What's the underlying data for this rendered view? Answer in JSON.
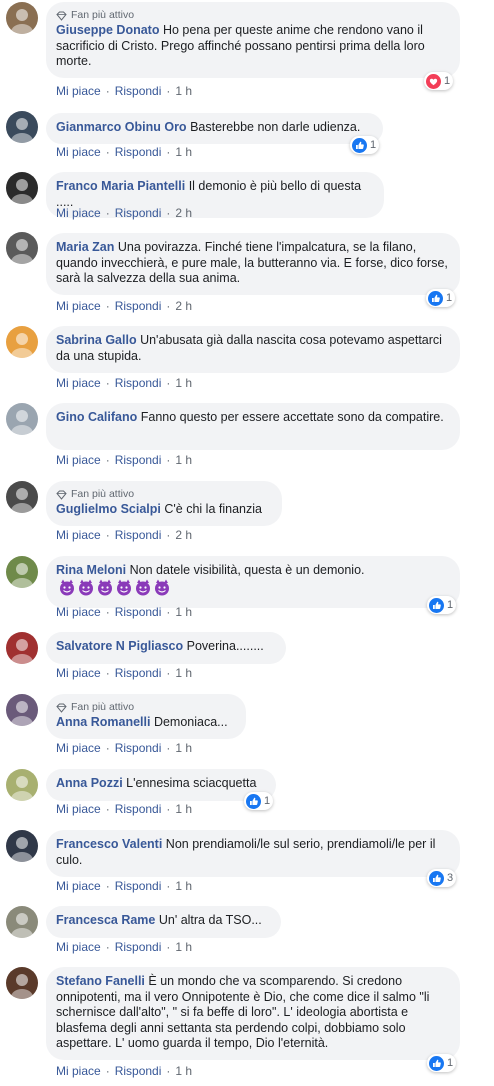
{
  "labels": {
    "fan_badge": "Fan più attivo",
    "like": "Mi piace",
    "reply": "Rispondi",
    "separator": "·"
  },
  "colors": {
    "link": "#385898",
    "bubble": "#f2f3f5",
    "muted": "#606770",
    "like_blue": "#1877f2",
    "love_red": "#f33e58"
  },
  "comments": [
    {
      "fan": true,
      "author": "Giuseppe Donato",
      "text": "Ho pena per queste anime che rendono vano il sacrificio di Cristo. Prego affinché possano pentirsi prima della loro morte.",
      "time": "1 h",
      "reaction": {
        "icon": "love-icon",
        "count": "1"
      },
      "avatar_color": "#8a6f52"
    },
    {
      "fan": false,
      "author": "Gianmarco Obinu Oro",
      "text": "Basterebbe non darle udienza.",
      "time": "1 h",
      "reaction": {
        "icon": "like-icon",
        "count": "1"
      },
      "avatar_color": "#3a4a5c"
    },
    {
      "fan": false,
      "author": "Franco Maria Piantelli",
      "text": "Il demonio è più bello di questa .....",
      "time": "2 h",
      "reaction": null,
      "avatar_color": "#2b2b2b"
    },
    {
      "fan": false,
      "author": "Maria Zan",
      "text": "Una povirazza. Finché tiene l'impalcatura, se la filano, quando invecchierà, e pure male, la butteranno via. E forse, dico forse, sarà la salvezza della sua anima.",
      "time": "2 h",
      "reaction": {
        "icon": "like-icon",
        "count": "1"
      },
      "avatar_color": "#5a5a5a"
    },
    {
      "fan": false,
      "author": "Sabrina Gallo",
      "text": "Un'abusata già dalla nascita cosa potevamo aspettarci da una stupida.",
      "time": "1 h",
      "reaction": null,
      "avatar_color": "#e8a040"
    },
    {
      "fan": false,
      "author": "Gino Califano",
      "text": "Fanno questo per essere accettate sono da compatire.",
      "time": "1 h",
      "reaction": null,
      "avatar_color": "#9aa5b0"
    },
    {
      "fan": true,
      "author": "Guglielmo Scialpi",
      "text": "C'è chi la finanzia",
      "time": "2 h",
      "reaction": null,
      "avatar_color": "#4a4a4a"
    },
    {
      "fan": false,
      "author": "Rina Meloni",
      "text": "Non datele visibilità, questa è un demonio.",
      "emoji": "😈😈😈😈😈😈",
      "time": "1 h",
      "reaction": {
        "icon": "like-icon",
        "count": "1"
      },
      "avatar_color": "#6f8a4a"
    },
    {
      "fan": false,
      "author": "Salvatore N Pigliasco",
      "text": "Poverina........",
      "time": "1 h",
      "reaction": null,
      "avatar_color": "#a03030"
    },
    {
      "fan": true,
      "author": "Anna Romanelli",
      "text": "Demoniaca...",
      "time": "1 h",
      "reaction": null,
      "avatar_color": "#6a5a7a"
    },
    {
      "fan": false,
      "author": "Anna Pozzi",
      "text": "L'ennesima sciacquetta",
      "time": "1 h",
      "reaction": {
        "icon": "like-icon",
        "count": "1"
      },
      "avatar_color": "#a8b070"
    },
    {
      "fan": false,
      "author": "Francesco Valenti",
      "text": "Non prendiamoli/le sul serio, prendiamoli/le per il culo.",
      "time": "1 h",
      "reaction": {
        "icon": "like-icon",
        "count": "3"
      },
      "avatar_color": "#303848"
    },
    {
      "fan": false,
      "author": "Francesca Rame",
      "text": "Un' altra da TSO...",
      "time": "1 h",
      "reaction": null,
      "avatar_color": "#8a8a7a"
    },
    {
      "fan": false,
      "author": "Stefano Fanelli",
      "text": "È un mondo che va scomparendo. Si credono onnipotenti, ma il vero Onnipotente è Dio, che come dice il salmo \"li schernisce dall'alto\", \" si fa beffe di loro\". L' ideologia abortista e blasfema degli anni settanta sta perdendo colpi, dobbiamo solo aspettare. L' uomo guarda il tempo, Dio l'eternità.",
      "time": "1 h",
      "reaction": {
        "icon": "like-icon",
        "count": "1"
      },
      "avatar_color": "#5a3a2a"
    }
  ]
}
